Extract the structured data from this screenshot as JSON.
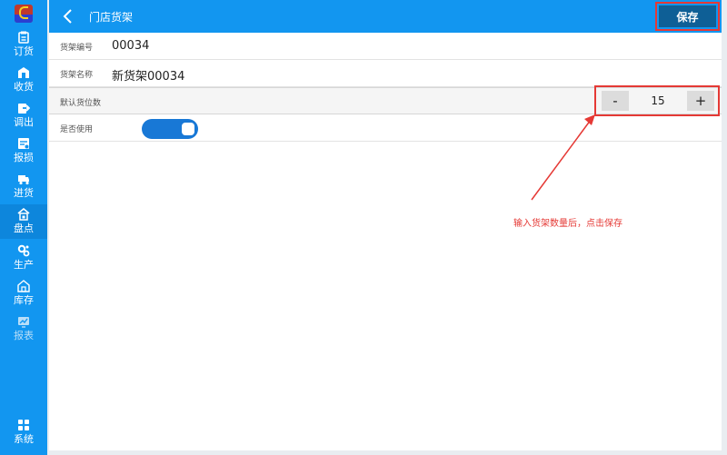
{
  "colors": {
    "sidebar": "#1296f0",
    "active": "#0d86dc",
    "save": "#0e5f96",
    "highlight": "#e53935",
    "toggle": "#1878d6"
  },
  "sidebar": {
    "items": [
      {
        "label": "订货",
        "icon": "order-icon"
      },
      {
        "label": "收货",
        "icon": "receive-icon"
      },
      {
        "label": "调出",
        "icon": "transfer-out-icon"
      },
      {
        "label": "报损",
        "icon": "loss-report-icon"
      },
      {
        "label": "进货",
        "icon": "truck-icon"
      },
      {
        "label": "盘点",
        "icon": "stocktake-icon",
        "active": true
      },
      {
        "label": "生产",
        "icon": "production-icon"
      },
      {
        "label": "库存",
        "icon": "warehouse-icon"
      },
      {
        "label": "报表",
        "icon": "report-icon",
        "dim": true
      },
      {
        "label": "系统",
        "icon": "grid-icon"
      }
    ]
  },
  "header": {
    "title": "门店货架",
    "save_label": "保存"
  },
  "form": {
    "code": {
      "label": "货架编号",
      "value": "00034"
    },
    "name": {
      "label": "货架名称",
      "value": "新货架00034"
    },
    "default_slots": {
      "label": "默认货位数",
      "value": "15",
      "minus": "-",
      "plus": "+"
    },
    "enabled": {
      "label": "是否使用",
      "on": true
    }
  },
  "annotation": "输入货架数量后，点击保存"
}
